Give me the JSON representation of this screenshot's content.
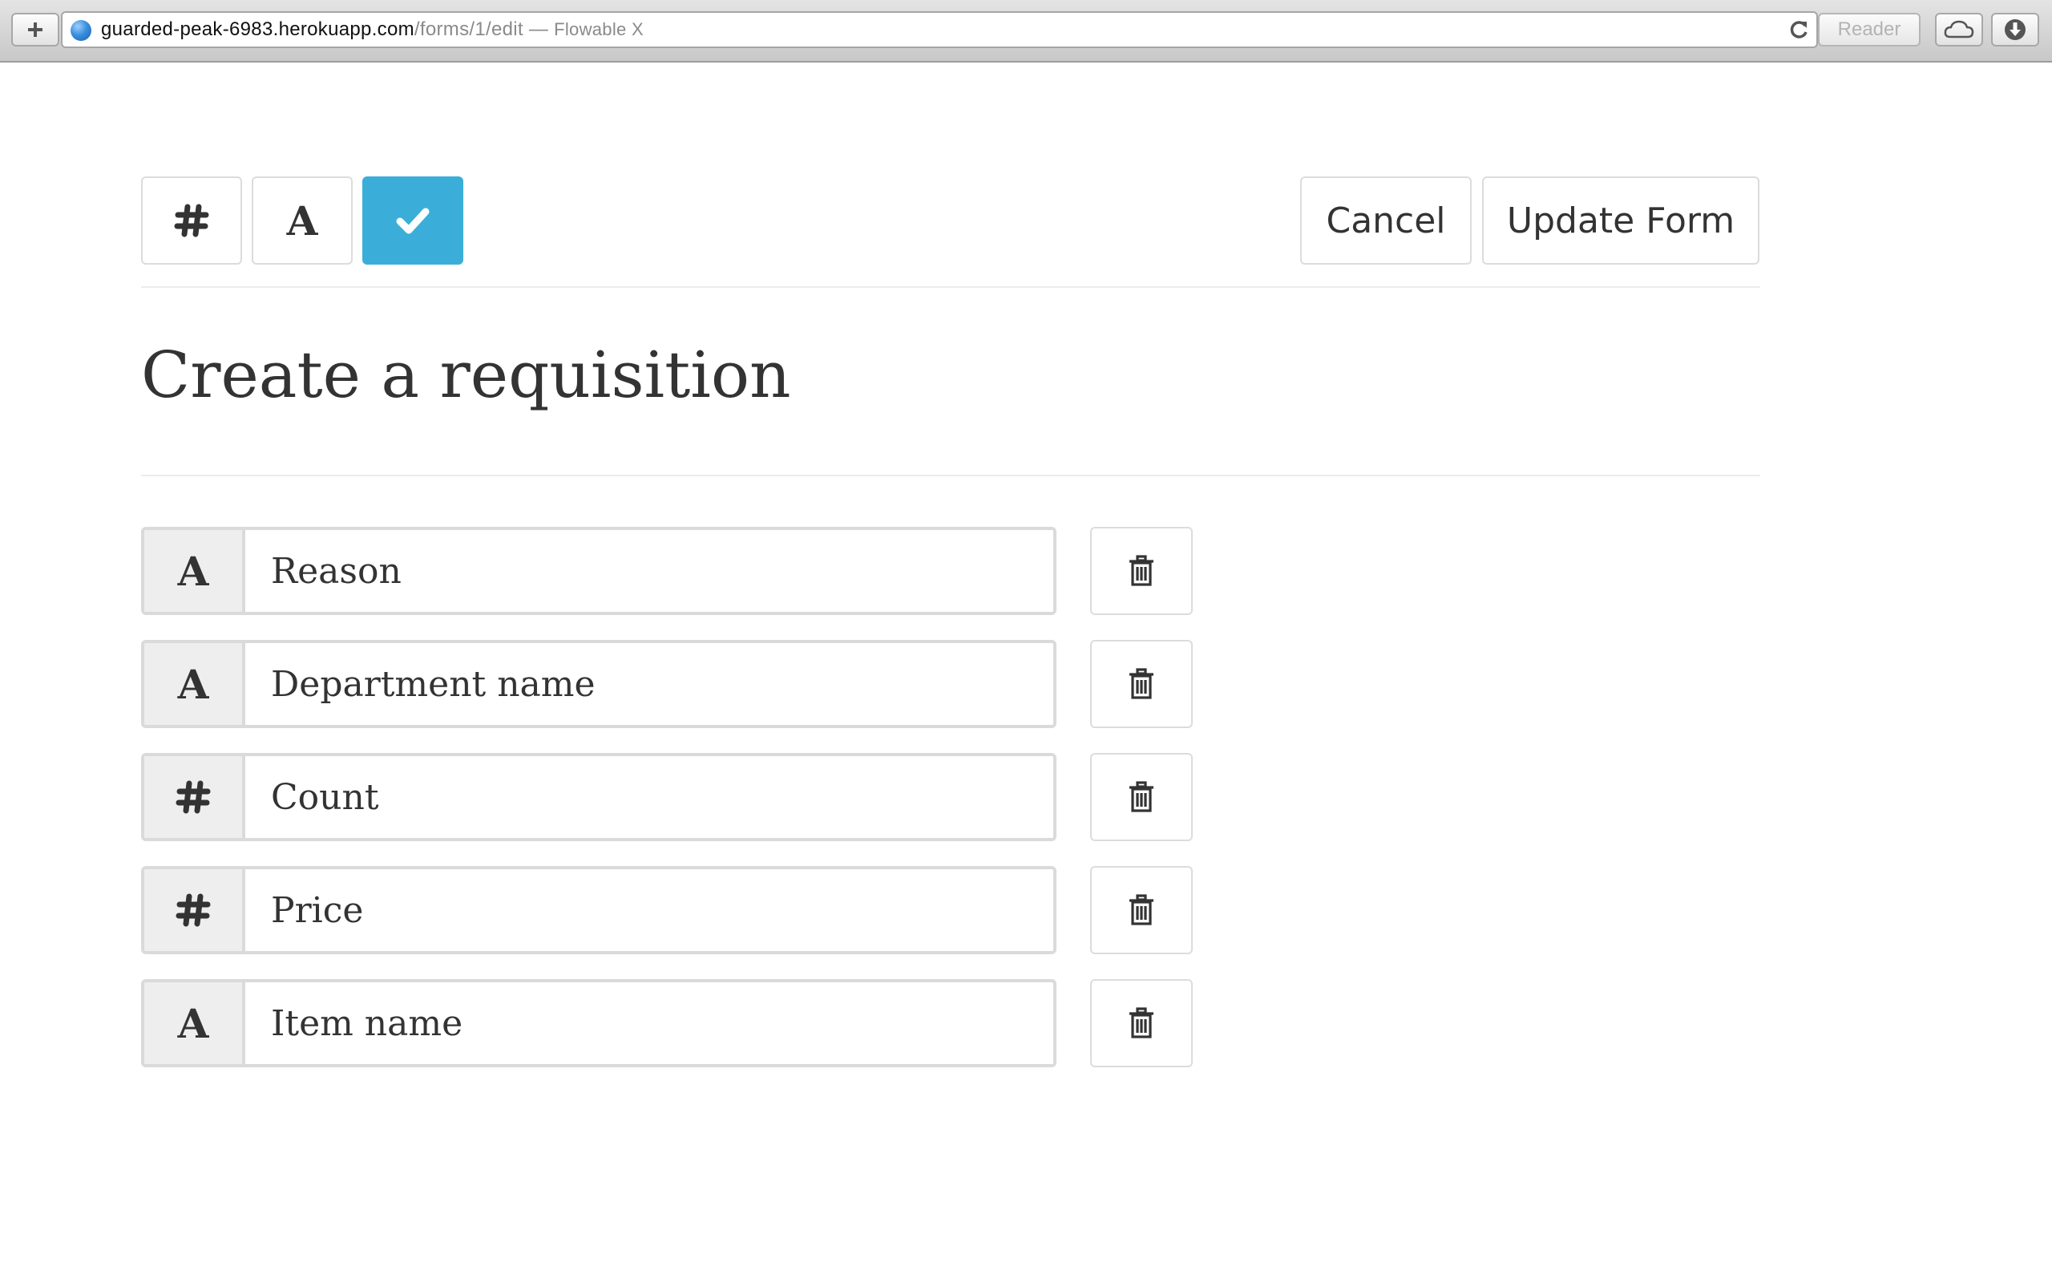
{
  "browser": {
    "url_host": "guarded-peak-6983.herokuapp.com",
    "url_path": "/forms/1/edit",
    "title_separator": " — ",
    "page_title": "Flowable X",
    "reader_label": "Reader"
  },
  "toolbar": {
    "number_icon": "hash-icon",
    "text_button_glyph": "A",
    "done_icon": "checkmark-icon",
    "cancel_label": "Cancel",
    "update_label": "Update Form"
  },
  "form": {
    "title": "Create a requisition",
    "fields": [
      {
        "type": "text",
        "type_glyph": "A",
        "value": "Reason"
      },
      {
        "type": "text",
        "type_glyph": "A",
        "value": "Department name"
      },
      {
        "type": "number",
        "type_glyph": "#",
        "value": "Count"
      },
      {
        "type": "number",
        "type_glyph": "#",
        "value": "Price"
      },
      {
        "type": "text",
        "type_glyph": "A",
        "value": "Item name"
      }
    ]
  },
  "colors": {
    "accent": "#3aaed8",
    "text": "#333333",
    "border": "#dadada"
  }
}
